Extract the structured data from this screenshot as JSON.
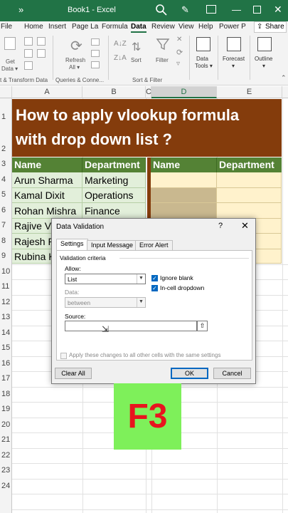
{
  "titlebar": {
    "chevron": "»",
    "title": "Book1 - Excel",
    "pen_glyph": "✎",
    "min_glyph": "—",
    "close_glyph": "✕"
  },
  "tabs": [
    "File",
    "Home",
    "Insert",
    "Page La",
    "Formula",
    "Data",
    "Review",
    "View",
    "Help",
    "Power P"
  ],
  "active_tab": "Data",
  "share_label": "Share",
  "ribbon": {
    "get_data_1": "Get",
    "get_data_2": "Data ▾",
    "group1": "t & Transform Data",
    "refresh_1": "Refresh",
    "refresh_2": "All ▾",
    "group2": "Queries & Conne...",
    "sort": "Sort",
    "filter": "Filter",
    "group3": "Sort & Filter",
    "data_tools_1": "Data",
    "data_tools_2": "Tools ▾",
    "forecast_1": "Forecast",
    "forecast_2": "▾",
    "outline_1": "Outline",
    "outline_2": "▾"
  },
  "columns": [
    "A",
    "B",
    "C",
    "D",
    "E"
  ],
  "rows": [
    "1",
    "2",
    "3",
    "4",
    "5",
    "6",
    "7",
    "8",
    "9",
    "10",
    "11",
    "12",
    "13",
    "14",
    "15",
    "16",
    "17",
    "18",
    "19",
    "20",
    "21",
    "22",
    "23",
    "24"
  ],
  "sheet_title_line1": "How to apply vlookup formula",
  "sheet_title_line2": "with drop down list ?",
  "left_table": {
    "headers": [
      "Name",
      "Department"
    ],
    "rows": [
      [
        "Arun Sharma",
        "Marketing"
      ],
      [
        "Kamal Dixit",
        "Operations"
      ],
      [
        "Rohan Mishra",
        "Finance"
      ],
      [
        "Rajive Ve",
        ""
      ],
      [
        "Rajesh P",
        ""
      ],
      [
        "Rubina K",
        ""
      ]
    ]
  },
  "right_table": {
    "headers": [
      "Name",
      "Department"
    ]
  },
  "dialog": {
    "title": "Data Validation",
    "help": "?",
    "close": "✕",
    "tabs": [
      "Settings",
      "Input Message",
      "Error Alert"
    ],
    "criteria": "Validation criteria",
    "allow_label": "Allow:",
    "allow_value": "List",
    "data_label": "Data:",
    "data_value": "between",
    "ignore_blank": "Ignore blank",
    "in_cell_dropdown": "In-cell dropdown",
    "source_label": "Source:",
    "source_value": "",
    "apply_all": "Apply these changes to all other cells with the same settings",
    "clear_all": "Clear All",
    "ok": "OK",
    "cancel": "Cancel"
  },
  "overlay_key": "F3"
}
